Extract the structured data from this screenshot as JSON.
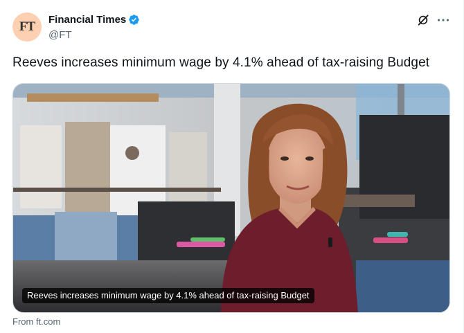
{
  "account": {
    "avatar_text": "FT",
    "display_name": "Financial Times",
    "handle": "@FT",
    "verified_icon": "verified-badge-icon",
    "avatar_color": "#fcd0b1",
    "verified_color": "#1d9bf0"
  },
  "header_actions": {
    "grok_icon": "grok-icon",
    "more_icon": "more-icon"
  },
  "tweet": {
    "text": "Reeves increases minimum wage by 4.1% ahead of tax-raising Budget"
  },
  "card": {
    "image_subject": "woman-in-clothing-store-photo",
    "caption": "Reeves increases minimum wage by 4.1% ahead of tax-raising Budget",
    "source": "From ft.com"
  }
}
